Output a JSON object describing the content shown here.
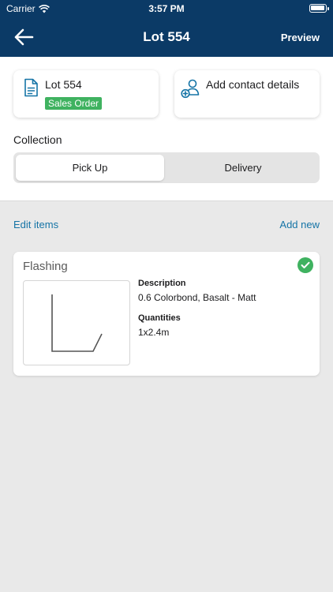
{
  "status": {
    "carrier": "Carrier",
    "time": "3:57 PM"
  },
  "nav": {
    "title": "Lot 554",
    "preview_label": "Preview"
  },
  "lot_card": {
    "title": "Lot 554",
    "badge": "Sales Order",
    "icon": "document-icon"
  },
  "contact_card": {
    "label": "Add contact details",
    "icon": "person-add-icon"
  },
  "collection": {
    "label": "Collection",
    "options": [
      "Pick Up",
      "Delivery"
    ],
    "selected": "Pick Up"
  },
  "items_header": {
    "edit_label": "Edit items",
    "add_label": "Add new"
  },
  "item": {
    "title": "Flashing",
    "completed": true,
    "description_label": "Description",
    "description": "0.6 Colorbond, Basalt - Matt",
    "quantities_label": "Quantities",
    "quantities": "1x2.4m"
  },
  "colors": {
    "header": "#0b3a66",
    "accent": "#1574a6",
    "success": "#3fb260"
  }
}
